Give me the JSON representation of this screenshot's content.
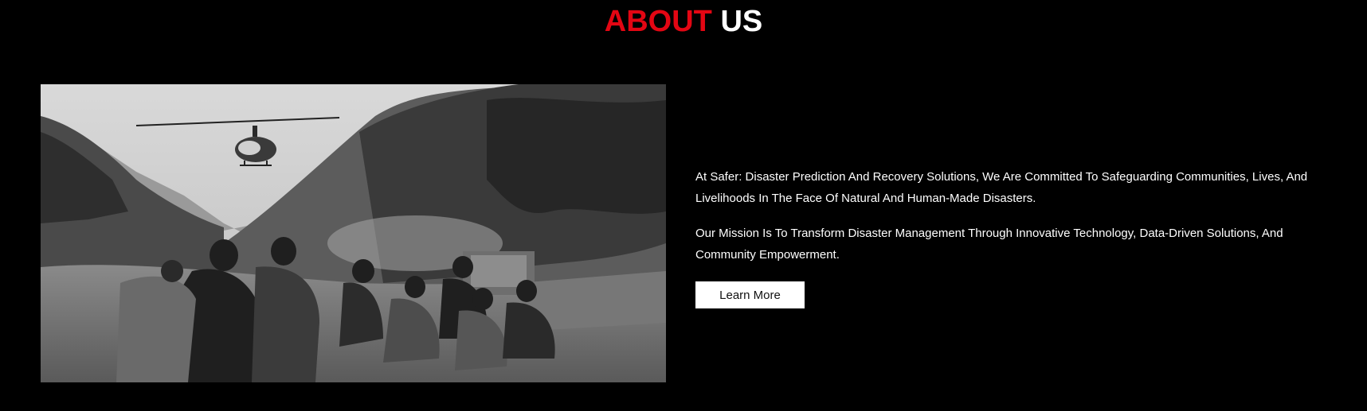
{
  "header": {
    "title_accent": "ABOUT",
    "title_rest": "US"
  },
  "about": {
    "image_alt": "Disaster rescue scene with helicopter",
    "paragraphs": [
      "At Safer: Disaster Prediction And Recovery Solutions, We Are Committed To Safeguarding Communities, Lives, And Livelihoods In The Face Of Natural And Human-Made Disasters.",
      "Our Mission Is To Transform Disaster Management Through Innovative Technology, Data-Driven Solutions, And Community Empowerment."
    ],
    "button_label": "Learn More"
  },
  "colors": {
    "background": "#000000",
    "accent": "#e30613",
    "text": "#ffffff",
    "button_bg": "#ffffff",
    "button_text": "#111111"
  }
}
